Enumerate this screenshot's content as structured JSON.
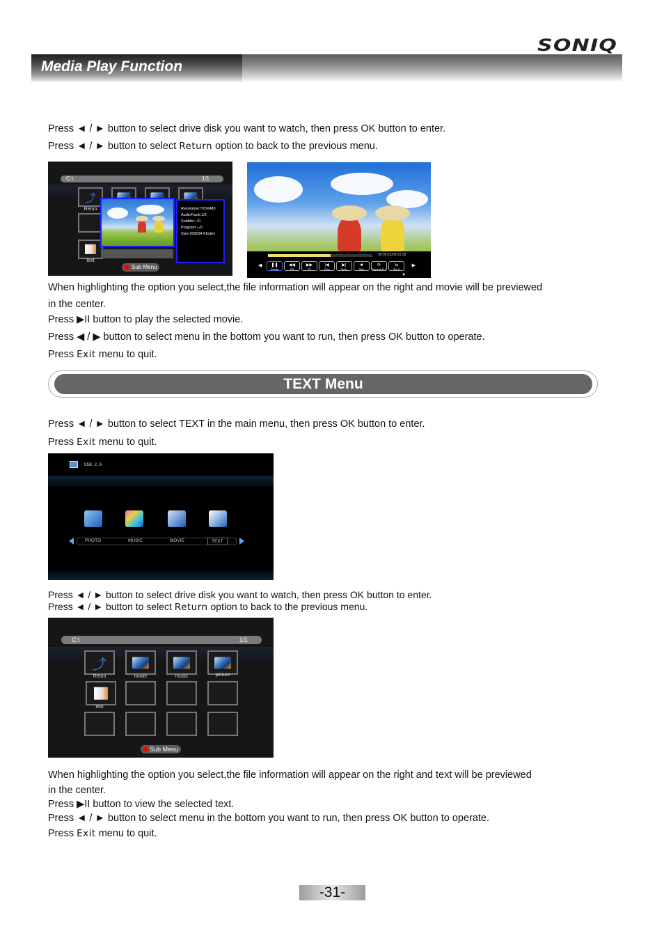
{
  "brand": "SONIQ",
  "header": {
    "title": "Media Play Function"
  },
  "section1": {
    "lines": [
      {
        "pre": "Press ◄ / ► button to select drive disk you want to watch,  then press OK button to enter."
      },
      {
        "pre": "Press ◄ / ► button to select ",
        "ret": "Return",
        "post": " option to back to the previous menu."
      }
    ]
  },
  "browser_screen": {
    "path": "C:\\",
    "page": "1/1",
    "tiles": [
      "Retun",
      "text"
    ],
    "info": [
      "Resolution:720X480",
      "AudioTrack:1/2",
      "Subtitle:--/0",
      "Program:--/0",
      "Size:269234 Kbytes"
    ],
    "submenu": "Sub Menu"
  },
  "video_screen": {
    "progress": 0.6,
    "time": "00:00:22/00:01:35",
    "buttons": [
      {
        "glyph": "❚❚",
        "label": "Pause"
      },
      {
        "glyph": "◀◀",
        "label": "FB"
      },
      {
        "glyph": "▶▶",
        "label": "FF"
      },
      {
        "glyph": "|◀",
        "label": "Prev"
      },
      {
        "glyph": "▶|",
        "label": "Next"
      },
      {
        "glyph": "■",
        "label": "Stop"
      },
      {
        "glyph": "⟳",
        "label": "Repeat ALL"
      },
      {
        "glyph": "⇆",
        "label": "Set A"
      }
    ]
  },
  "section2": {
    "lines": [
      "When highlighting the option you select,the file information will appear on the right and movie will be previewed",
      "in the center.",
      "Press ▶II button to play the selected movie.",
      "Press ◀ / ▶ button to select menu in the bottom you want to run,  then press OK button to operate."
    ],
    "exit": {
      "pre": "Press ",
      "ret": "Exit",
      "post": " menu to quit."
    }
  },
  "text_menu": {
    "title": "TEXT Menu",
    "line1": "Press ◄ / ► button to select TEXT in the main menu,  then press OK button to enter.",
    "exit": {
      "pre": "Press ",
      "ret": "Exit",
      "post": " menu to quit."
    }
  },
  "main_menu_screen": {
    "device": "USB 2.0",
    "items": [
      "PHOTO",
      "MUSIC",
      "MOVIE",
      "TEXT"
    ],
    "selected": "TEXT"
  },
  "section3": {
    "lines": [
      {
        "pre": "Press ◄ / ► button to select drive disk you want to watch,  then press OK button to enter."
      },
      {
        "pre": "Press ◄ / ► button to select ",
        "ret": "Return",
        "post": " option to back to the previous menu."
      }
    ]
  },
  "folder_screen": {
    "path": "C:\\",
    "page": "1/1",
    "tiles": [
      "Retun",
      "movie",
      "music",
      "picture",
      "text"
    ],
    "submenu": "Sub Menu"
  },
  "section4": {
    "lines": [
      "When highlighting the option you select,the file information will appear on the right and text will be previewed",
      "in the center.",
      "Press ▶II  button to view the selected text.",
      "Press ◄ / ► button to select menu in the bottom you want to run,  then press OK button to operate."
    ],
    "exit": {
      "pre": "Press ",
      "ret": "Exit",
      "post": " menu to quit."
    }
  },
  "page_number": "-31-"
}
